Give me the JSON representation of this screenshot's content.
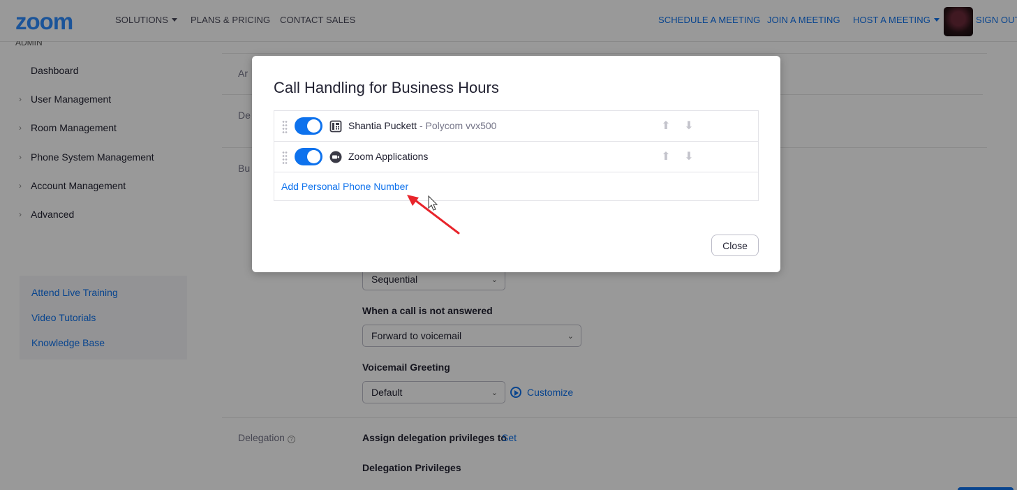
{
  "header": {
    "logo": "zoom",
    "nav_left": [
      "SOLUTIONS",
      "PLANS & PRICING",
      "CONTACT SALES"
    ],
    "nav_right": [
      "SCHEDULE A MEETING",
      "JOIN A MEETING",
      "HOST A MEETING",
      "SIGN OUT"
    ]
  },
  "sidebar": {
    "section": "ADMIN",
    "items": [
      {
        "label": "Dashboard"
      },
      {
        "label": "User Management"
      },
      {
        "label": "Room Management"
      },
      {
        "label": "Phone System Management"
      },
      {
        "label": "Account Management"
      },
      {
        "label": "Advanced"
      }
    ],
    "links": [
      "Attend Live Training",
      "Video Tutorials",
      "Knowledge Base"
    ]
  },
  "main": {
    "row_label_1": "Ar",
    "row_label_2": "De",
    "row_label_3": "Bu",
    "ring_mode": "Sequential",
    "not_answered_label": "When a call is not answered",
    "not_answered_value": "Forward to voicemail",
    "greeting_label": "Voicemail Greeting",
    "greeting_value": "Default",
    "customize": "Customize",
    "delegation_label": "Delegation",
    "assign_label": "Assign delegation privileges to",
    "set_link": "Set",
    "privileges_label": "Delegation Privileges"
  },
  "modal": {
    "title": "Call Handling for Business Hours",
    "rows": [
      {
        "name": "Shantia Puckett",
        "sub": " - Polycom vvx500",
        "enabled": true,
        "icon": "desk-phone-icon"
      },
      {
        "name": "Zoom Applications",
        "sub": "",
        "enabled": true,
        "icon": "zoom-camera-icon"
      }
    ],
    "add_link": "Add Personal Phone Number",
    "close_label": "Close"
  },
  "colors": {
    "brand": "#2d8cff",
    "link": "#0e72ed",
    "annotation_arrow": "#e8242b"
  }
}
